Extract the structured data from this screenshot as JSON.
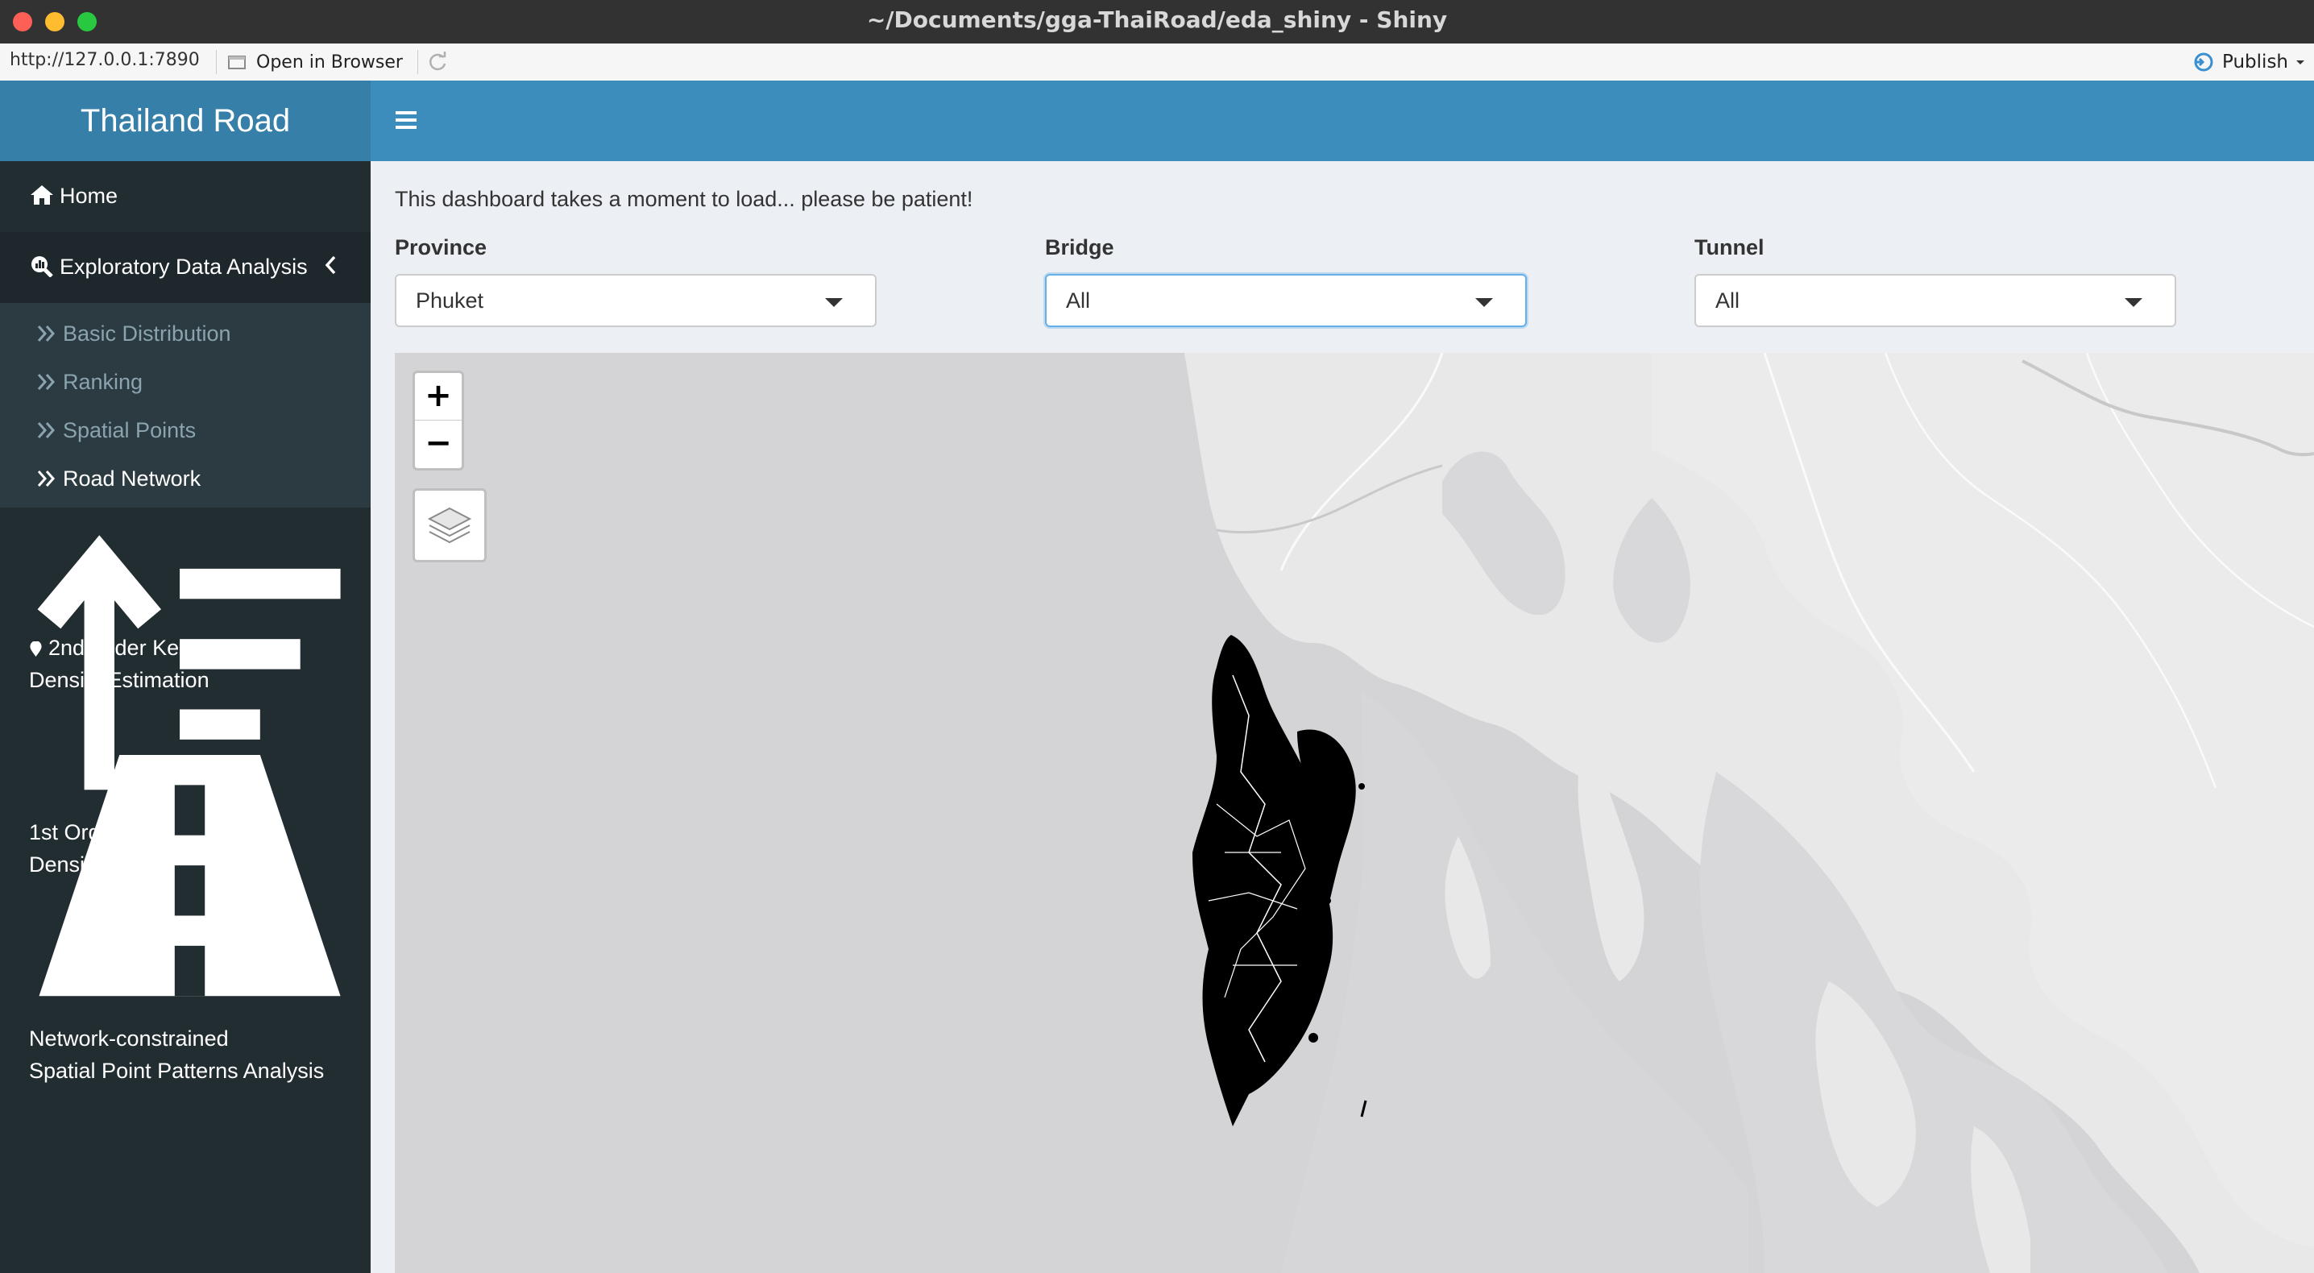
{
  "window": {
    "title": "~/Documents/gga-ThaiRoad/eda_shiny - Shiny",
    "url": "http://127.0.0.1:7890",
    "open_in_browser": "Open in Browser",
    "publish": "Publish"
  },
  "sidebar": {
    "brand": "Thailand Road",
    "home": "Home",
    "eda": "Exploratory Data Analysis",
    "eda_items": [
      "Basic Distribution",
      "Ranking",
      "Spatial Points",
      "Road Network"
    ],
    "active_item": "Road Network",
    "kde1_line1": "1st Order Kernel",
    "kde1_line2": "Density Estimation",
    "kde2_line1": "2nd Order Kernel",
    "kde2_line2": "Density Estimation",
    "net_line1": "Network-constrained",
    "net_line2": "Spatial Point Patterns Analysis"
  },
  "main": {
    "notice": "This dashboard takes a moment to load... please be patient!",
    "filters": [
      {
        "label": "Province",
        "value": "Phuket"
      },
      {
        "label": "Bridge",
        "value": "All"
      },
      {
        "label": "Tunnel",
        "value": "All"
      }
    ]
  },
  "map": {
    "zoom_in": "+",
    "zoom_out": "−"
  },
  "colors": {
    "header": "#3c8dbc",
    "brand": "#367fa9",
    "sidebar": "#222d32",
    "map_sea": "#d4d3d6",
    "map_land": "#e8e8e8",
    "roads": "#000000"
  },
  "icons": [
    "home-icon",
    "search-chart-icon",
    "chevron-left-icon",
    "double-chevron-icon",
    "sort-icon",
    "map-marker-icon",
    "road-icon",
    "hamburger-icon",
    "layers-icon",
    "refresh-icon",
    "publish-icon"
  ]
}
